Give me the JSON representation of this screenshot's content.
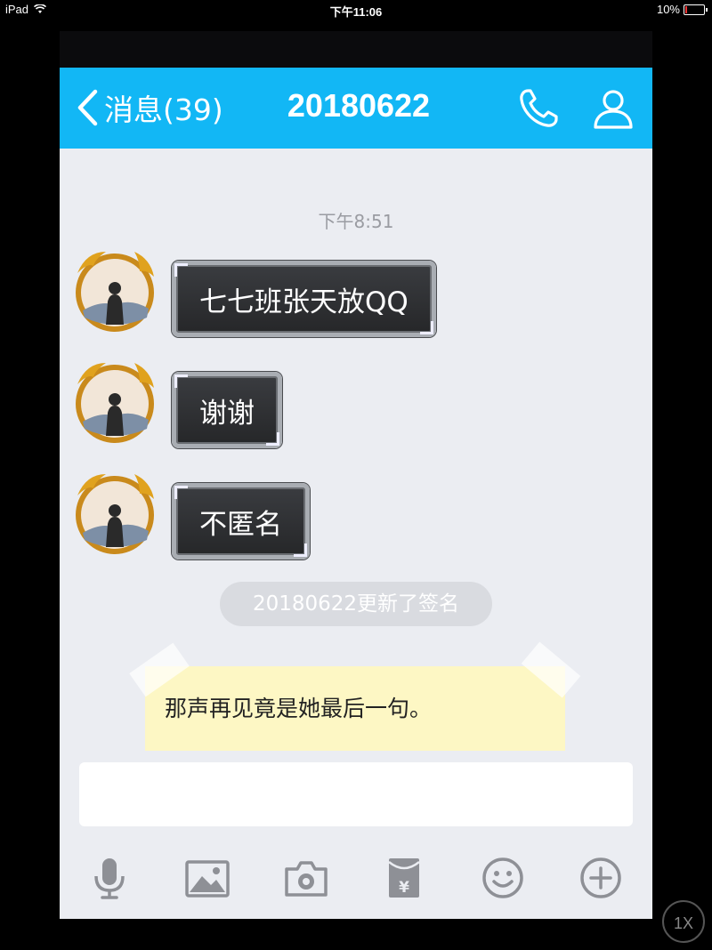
{
  "status_bar": {
    "device": "iPad",
    "time": "下午11:06",
    "battery": "10%",
    "battery_level": 0.1
  },
  "nav": {
    "back_label": "消息(39)",
    "title": "20180622"
  },
  "chat": {
    "timestamp": "下午8:51",
    "messages": [
      {
        "text": "七七班张天放QQ"
      },
      {
        "text": "谢谢"
      },
      {
        "text": "不匿名"
      }
    ],
    "system_notice": "20180622更新了签名",
    "signature": "那声再见竟是她最后一句。"
  },
  "toolbar": {
    "icons": [
      "microphone-icon",
      "image-icon",
      "camera-icon",
      "red-packet-icon",
      "emoji-icon",
      "plus-icon"
    ]
  },
  "zoom_label": "1X",
  "colors": {
    "nav_bg": "#12b7f5",
    "chat_bg": "#ebedf2",
    "bubble_bg": "#2f3033",
    "toolbar_icon": "#8e9096"
  }
}
